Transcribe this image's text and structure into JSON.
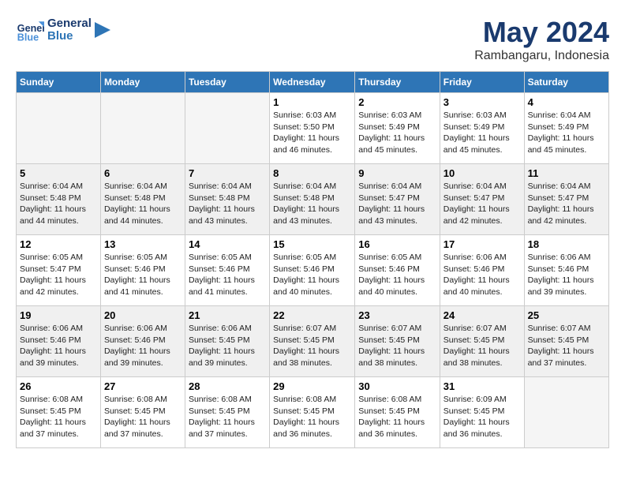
{
  "header": {
    "logo_general": "General",
    "logo_blue": "Blue",
    "month_title": "May 2024",
    "location": "Rambangaru, Indonesia"
  },
  "weekdays": [
    "Sunday",
    "Monday",
    "Tuesday",
    "Wednesday",
    "Thursday",
    "Friday",
    "Saturday"
  ],
  "weeks": [
    [
      {
        "day": "",
        "sunrise": "",
        "sunset": "",
        "daylight": "",
        "empty": true
      },
      {
        "day": "",
        "sunrise": "",
        "sunset": "",
        "daylight": "",
        "empty": true
      },
      {
        "day": "",
        "sunrise": "",
        "sunset": "",
        "daylight": "",
        "empty": true
      },
      {
        "day": "1",
        "sunrise": "Sunrise: 6:03 AM",
        "sunset": "Sunset: 5:50 PM",
        "daylight": "Daylight: 11 hours and 46 minutes.",
        "empty": false
      },
      {
        "day": "2",
        "sunrise": "Sunrise: 6:03 AM",
        "sunset": "Sunset: 5:49 PM",
        "daylight": "Daylight: 11 hours and 45 minutes.",
        "empty": false
      },
      {
        "day": "3",
        "sunrise": "Sunrise: 6:03 AM",
        "sunset": "Sunset: 5:49 PM",
        "daylight": "Daylight: 11 hours and 45 minutes.",
        "empty": false
      },
      {
        "day": "4",
        "sunrise": "Sunrise: 6:04 AM",
        "sunset": "Sunset: 5:49 PM",
        "daylight": "Daylight: 11 hours and 45 minutes.",
        "empty": false
      }
    ],
    [
      {
        "day": "5",
        "sunrise": "Sunrise: 6:04 AM",
        "sunset": "Sunset: 5:48 PM",
        "daylight": "Daylight: 11 hours and 44 minutes.",
        "empty": false
      },
      {
        "day": "6",
        "sunrise": "Sunrise: 6:04 AM",
        "sunset": "Sunset: 5:48 PM",
        "daylight": "Daylight: 11 hours and 44 minutes.",
        "empty": false
      },
      {
        "day": "7",
        "sunrise": "Sunrise: 6:04 AM",
        "sunset": "Sunset: 5:48 PM",
        "daylight": "Daylight: 11 hours and 43 minutes.",
        "empty": false
      },
      {
        "day": "8",
        "sunrise": "Sunrise: 6:04 AM",
        "sunset": "Sunset: 5:48 PM",
        "daylight": "Daylight: 11 hours and 43 minutes.",
        "empty": false
      },
      {
        "day": "9",
        "sunrise": "Sunrise: 6:04 AM",
        "sunset": "Sunset: 5:47 PM",
        "daylight": "Daylight: 11 hours and 43 minutes.",
        "empty": false
      },
      {
        "day": "10",
        "sunrise": "Sunrise: 6:04 AM",
        "sunset": "Sunset: 5:47 PM",
        "daylight": "Daylight: 11 hours and 42 minutes.",
        "empty": false
      },
      {
        "day": "11",
        "sunrise": "Sunrise: 6:04 AM",
        "sunset": "Sunset: 5:47 PM",
        "daylight": "Daylight: 11 hours and 42 minutes.",
        "empty": false
      }
    ],
    [
      {
        "day": "12",
        "sunrise": "Sunrise: 6:05 AM",
        "sunset": "Sunset: 5:47 PM",
        "daylight": "Daylight: 11 hours and 42 minutes.",
        "empty": false
      },
      {
        "day": "13",
        "sunrise": "Sunrise: 6:05 AM",
        "sunset": "Sunset: 5:46 PM",
        "daylight": "Daylight: 11 hours and 41 minutes.",
        "empty": false
      },
      {
        "day": "14",
        "sunrise": "Sunrise: 6:05 AM",
        "sunset": "Sunset: 5:46 PM",
        "daylight": "Daylight: 11 hours and 41 minutes.",
        "empty": false
      },
      {
        "day": "15",
        "sunrise": "Sunrise: 6:05 AM",
        "sunset": "Sunset: 5:46 PM",
        "daylight": "Daylight: 11 hours and 40 minutes.",
        "empty": false
      },
      {
        "day": "16",
        "sunrise": "Sunrise: 6:05 AM",
        "sunset": "Sunset: 5:46 PM",
        "daylight": "Daylight: 11 hours and 40 minutes.",
        "empty": false
      },
      {
        "day": "17",
        "sunrise": "Sunrise: 6:06 AM",
        "sunset": "Sunset: 5:46 PM",
        "daylight": "Daylight: 11 hours and 40 minutes.",
        "empty": false
      },
      {
        "day": "18",
        "sunrise": "Sunrise: 6:06 AM",
        "sunset": "Sunset: 5:46 PM",
        "daylight": "Daylight: 11 hours and 39 minutes.",
        "empty": false
      }
    ],
    [
      {
        "day": "19",
        "sunrise": "Sunrise: 6:06 AM",
        "sunset": "Sunset: 5:46 PM",
        "daylight": "Daylight: 11 hours and 39 minutes.",
        "empty": false
      },
      {
        "day": "20",
        "sunrise": "Sunrise: 6:06 AM",
        "sunset": "Sunset: 5:46 PM",
        "daylight": "Daylight: 11 hours and 39 minutes.",
        "empty": false
      },
      {
        "day": "21",
        "sunrise": "Sunrise: 6:06 AM",
        "sunset": "Sunset: 5:45 PM",
        "daylight": "Daylight: 11 hours and 39 minutes.",
        "empty": false
      },
      {
        "day": "22",
        "sunrise": "Sunrise: 6:07 AM",
        "sunset": "Sunset: 5:45 PM",
        "daylight": "Daylight: 11 hours and 38 minutes.",
        "empty": false
      },
      {
        "day": "23",
        "sunrise": "Sunrise: 6:07 AM",
        "sunset": "Sunset: 5:45 PM",
        "daylight": "Daylight: 11 hours and 38 minutes.",
        "empty": false
      },
      {
        "day": "24",
        "sunrise": "Sunrise: 6:07 AM",
        "sunset": "Sunset: 5:45 PM",
        "daylight": "Daylight: 11 hours and 38 minutes.",
        "empty": false
      },
      {
        "day": "25",
        "sunrise": "Sunrise: 6:07 AM",
        "sunset": "Sunset: 5:45 PM",
        "daylight": "Daylight: 11 hours and 37 minutes.",
        "empty": false
      }
    ],
    [
      {
        "day": "26",
        "sunrise": "Sunrise: 6:08 AM",
        "sunset": "Sunset: 5:45 PM",
        "daylight": "Daylight: 11 hours and 37 minutes.",
        "empty": false
      },
      {
        "day": "27",
        "sunrise": "Sunrise: 6:08 AM",
        "sunset": "Sunset: 5:45 PM",
        "daylight": "Daylight: 11 hours and 37 minutes.",
        "empty": false
      },
      {
        "day": "28",
        "sunrise": "Sunrise: 6:08 AM",
        "sunset": "Sunset: 5:45 PM",
        "daylight": "Daylight: 11 hours and 37 minutes.",
        "empty": false
      },
      {
        "day": "29",
        "sunrise": "Sunrise: 6:08 AM",
        "sunset": "Sunset: 5:45 PM",
        "daylight": "Daylight: 11 hours and 36 minutes.",
        "empty": false
      },
      {
        "day": "30",
        "sunrise": "Sunrise: 6:08 AM",
        "sunset": "Sunset: 5:45 PM",
        "daylight": "Daylight: 11 hours and 36 minutes.",
        "empty": false
      },
      {
        "day": "31",
        "sunrise": "Sunrise: 6:09 AM",
        "sunset": "Sunset: 5:45 PM",
        "daylight": "Daylight: 11 hours and 36 minutes.",
        "empty": false
      },
      {
        "day": "",
        "sunrise": "",
        "sunset": "",
        "daylight": "",
        "empty": true
      }
    ]
  ]
}
